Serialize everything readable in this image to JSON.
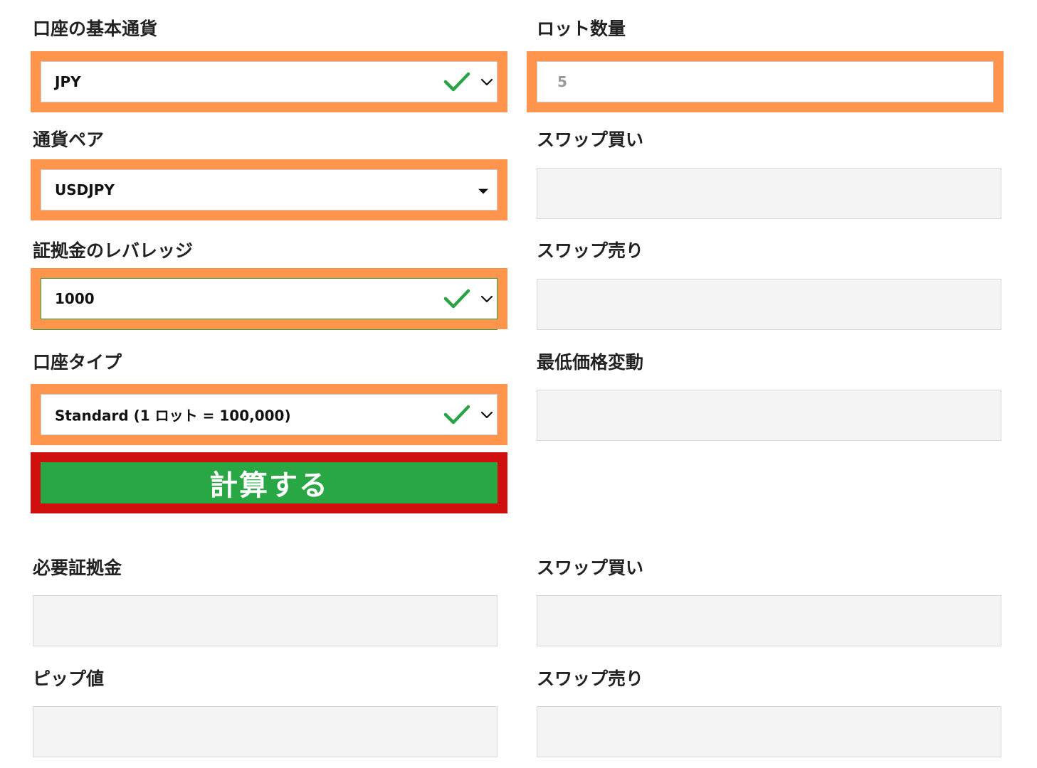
{
  "form": {
    "account_currency": {
      "label": "口座の基本通貨",
      "value": "JPY"
    },
    "lot_size": {
      "label": "ロット数量",
      "placeholder": "5"
    },
    "currency_pair": {
      "label": "通貨ペア",
      "value": "USDJPY"
    },
    "leverage": {
      "label": "証拠金のレバレッジ",
      "value": "1000"
    },
    "account_type": {
      "label": "口座タイプ",
      "value": "Standard (1 ロット = 100,000)"
    },
    "swap_buy": {
      "label": "スワップ買い"
    },
    "swap_sell": {
      "label": "スワップ売り"
    },
    "min_price_change": {
      "label": "最低価格変動"
    },
    "calculate_button": {
      "label": "計算する"
    }
  },
  "results": {
    "required_margin": {
      "label": "必要証拠金"
    },
    "pip_value": {
      "label": "ピップ値"
    },
    "swap_buy": {
      "label": "スワップ買い"
    },
    "swap_sell": {
      "label": "スワップ売り"
    }
  },
  "colors": {
    "highlight_orange": "#ff944d",
    "highlight_red": "#d00f0f",
    "button_green": "#29a744",
    "check_green": "#2aa345",
    "readonly_bg": "#f4f4f4"
  },
  "icons": {
    "valid": "check-icon",
    "dropdown": "chevron-down-icon",
    "select_caret": "caret-down-icon"
  }
}
